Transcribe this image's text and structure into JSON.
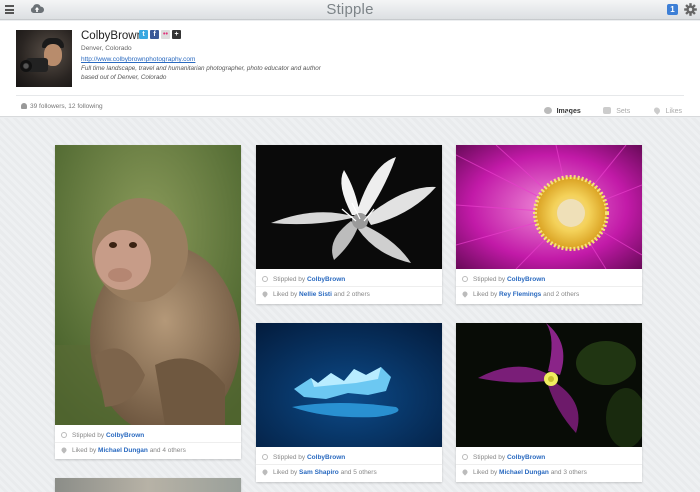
{
  "topbar": {
    "brand": "Stipple",
    "notification_count": "1"
  },
  "profile": {
    "name": "ColbyBrown",
    "location": "Denver, Colorado",
    "website": "http://www.colbybrownphotography.com",
    "bio": "Full time landscape, travel and humanitarian photographer, photo educator and author based out of Denver, Colorado",
    "followers": "39 followers, 12 following",
    "socials": [
      "twitter-icon",
      "facebook-icon",
      "flickr-icon",
      "plus-icon"
    ]
  },
  "tabs": [
    {
      "label": "Images",
      "icon": "image-icon"
    },
    {
      "label": "Sets",
      "icon": "sets-icon"
    },
    {
      "label": "Likes",
      "icon": "heart-icon"
    }
  ],
  "cards": [
    {
      "stippled_prefix": "Stippled by",
      "stippled_by": "ColbyBrown",
      "liked_prefix": "Liked by",
      "liked_by": "Michael Dungan",
      "liked_suffix": "and 4 others",
      "subject": "monkey"
    },
    {
      "stippled_prefix": "Stippled by",
      "stippled_by": "ColbyBrown",
      "liked_prefix": "Liked by",
      "liked_by": "Nellie Sisti",
      "liked_suffix": "and 2 others",
      "subject": "white-flower"
    },
    {
      "stippled_prefix": "Stippled by",
      "stippled_by": "ColbyBrown",
      "liked_prefix": "Liked by",
      "liked_by": "Rey Flemings",
      "liked_suffix": "and 2 others",
      "subject": "purple-flower"
    },
    {
      "stippled_prefix": "Stippled by",
      "stippled_by": "ColbyBrown",
      "liked_prefix": "Liked by",
      "liked_by": "Sam Shapiro",
      "liked_suffix": "and 5 others",
      "subject": "blue-ice"
    },
    {
      "stippled_prefix": "Stippled by",
      "stippled_by": "ColbyBrown",
      "liked_prefix": "Liked by",
      "liked_by": "Michael Dungan",
      "liked_suffix": "and 3 others",
      "subject": "bougainvillea"
    }
  ],
  "colors": {
    "link": "#2a6ac0",
    "accent": "#3d7fd6"
  }
}
